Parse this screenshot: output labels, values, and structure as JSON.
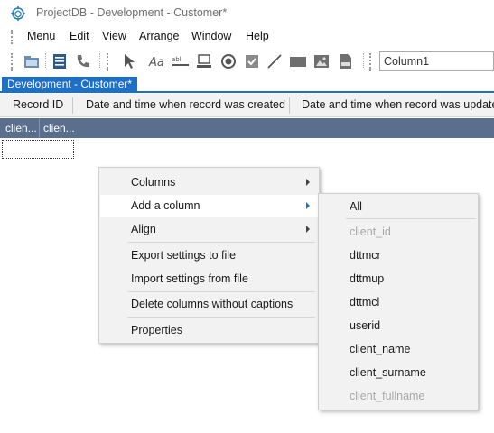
{
  "window": {
    "title": "ProjectDB - Development - Customer*"
  },
  "menu": [
    "Menu",
    "Edit",
    "View",
    "Arrange",
    "Window",
    "Help"
  ],
  "toolbar": {
    "icons": [
      "open-icon",
      "list-icon",
      "phone-icon",
      "pointer-icon",
      "label-text-icon",
      "edit-field-icon",
      "keyboard-icon",
      "radio-icon",
      "checkbox-icon",
      "line-icon",
      "rectangle-icon",
      "image-icon",
      "file-icon"
    ],
    "column_combo": "Column1"
  },
  "document_tab": "Development - Customer*",
  "captions": [
    "Record ID",
    "Date and time when record was created",
    "Date and time when record was updated"
  ],
  "grid": {
    "headers": [
      "clien...",
      "clien..."
    ]
  },
  "context_menu": {
    "items": [
      {
        "label": "Columns",
        "submenu": true
      },
      {
        "label": "Add a column",
        "submenu": true,
        "active": true
      },
      {
        "label": "Align",
        "submenu": true
      },
      {
        "label": "Export settings to file"
      },
      {
        "label": "Import settings from file"
      },
      {
        "label": "Delete columns without captions"
      },
      {
        "label": "Properties"
      }
    ]
  },
  "submenu": {
    "items": [
      {
        "label": "All",
        "enabled": true
      },
      {
        "label": "client_id",
        "enabled": false
      },
      {
        "label": "dttmcr",
        "enabled": true
      },
      {
        "label": "dttmup",
        "enabled": true
      },
      {
        "label": "dttmcl",
        "enabled": true
      },
      {
        "label": "userid",
        "enabled": true
      },
      {
        "label": "client_name",
        "enabled": true
      },
      {
        "label": "client_surname",
        "enabled": true
      },
      {
        "label": "client_fullname",
        "enabled": false
      }
    ]
  },
  "colors": {
    "accent": "#1e6fc8",
    "grid_header": "#5a6f8e",
    "menu_bg": "#f2f2f2",
    "disabled_text": "#a8a8a8"
  }
}
